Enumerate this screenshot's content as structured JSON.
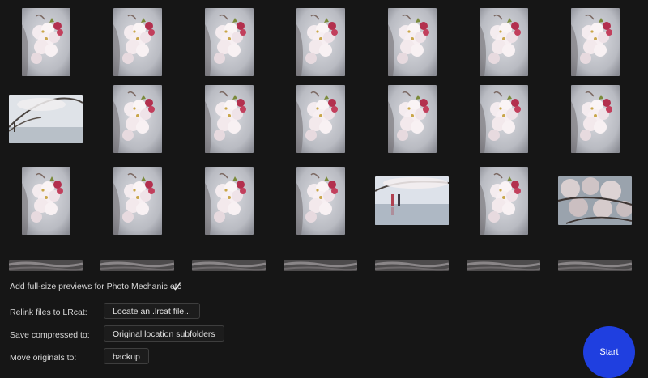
{
  "thumbnails": [
    {
      "kind": "blossom-portrait"
    },
    {
      "kind": "blossom-portrait"
    },
    {
      "kind": "blossom-portrait"
    },
    {
      "kind": "blossom-portrait"
    },
    {
      "kind": "blossom-portrait"
    },
    {
      "kind": "blossom-portrait"
    },
    {
      "kind": "blossom-portrait"
    },
    {
      "kind": "tree-landscape"
    },
    {
      "kind": "blossom-portrait"
    },
    {
      "kind": "blossom-portrait"
    },
    {
      "kind": "blossom-portrait"
    },
    {
      "kind": "blossom-portrait"
    },
    {
      "kind": "blossom-portrait"
    },
    {
      "kind": "blossom-portrait"
    },
    {
      "kind": "blossom-portrait"
    },
    {
      "kind": "blossom-portrait"
    },
    {
      "kind": "blossom-portrait"
    },
    {
      "kind": "blossom-portrait"
    },
    {
      "kind": "people-landscape"
    },
    {
      "kind": "blossom-portrait"
    },
    {
      "kind": "branches-landscape"
    },
    {
      "kind": "partial"
    },
    {
      "kind": "partial"
    },
    {
      "kind": "partial"
    },
    {
      "kind": "partial"
    },
    {
      "kind": "partial"
    },
    {
      "kind": "partial"
    },
    {
      "kind": "partial"
    }
  ],
  "options": {
    "previews_label": "Add full-size previews for Photo Mechanic etc",
    "previews_checked": true,
    "relink_label": "Relink files to LRcat:",
    "relink_value": "Locate an .lrcat file...",
    "save_label": "Save compressed to:",
    "save_value": "Original location subfolders",
    "move_label": "Move originals to:",
    "move_value": "backup"
  },
  "start_label": "Start",
  "colors": {
    "background": "#161616",
    "accent": "#1f3fe0",
    "field_border": "#3e3e3e",
    "text": "#d6d6d6"
  }
}
